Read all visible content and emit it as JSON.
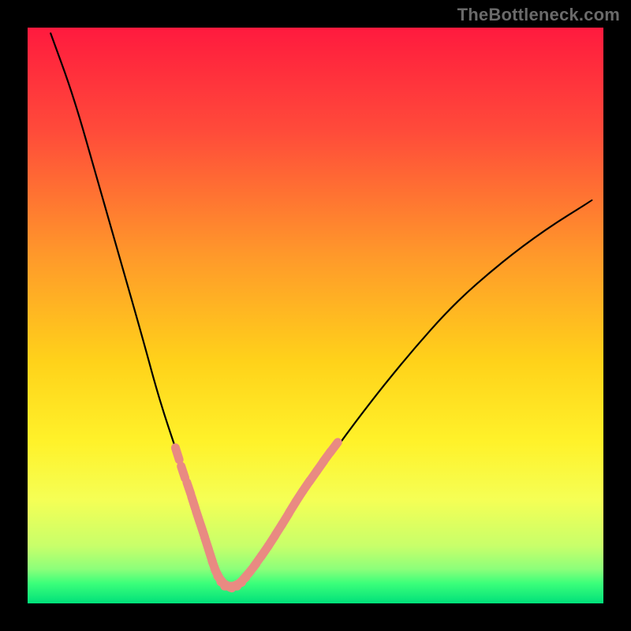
{
  "attribution": "TheBottleneck.com",
  "chart_data": {
    "type": "line",
    "title": "",
    "xlabel": "",
    "ylabel": "",
    "xlim": [
      0,
      100
    ],
    "ylim": [
      0,
      100
    ],
    "note": "V-shaped bottleneck curve over a red→yellow→green vertical gradient. Axes are unlabeled; x/y are normalized 0–100. Small salmon dash markers cluster near the valley on both arms.",
    "gradient_stops": [
      {
        "offset": 0.0,
        "color": "#ff1a3e"
      },
      {
        "offset": 0.18,
        "color": "#ff4b3a"
      },
      {
        "offset": 0.4,
        "color": "#ff9a2a"
      },
      {
        "offset": 0.58,
        "color": "#ffd21a"
      },
      {
        "offset": 0.72,
        "color": "#fff22a"
      },
      {
        "offset": 0.82,
        "color": "#f5ff55"
      },
      {
        "offset": 0.9,
        "color": "#c8ff6a"
      },
      {
        "offset": 0.94,
        "color": "#8dff7a"
      },
      {
        "offset": 0.965,
        "color": "#3cff7a"
      },
      {
        "offset": 1.0,
        "color": "#00e07a"
      }
    ],
    "series": [
      {
        "name": "bottleneck-curve",
        "x": [
          4,
          8,
          12,
          16,
          20,
          23,
          26,
          28,
          30,
          31.5,
          33,
          34.5,
          36,
          38,
          40,
          44,
          50,
          58,
          66,
          74,
          82,
          90,
          98
        ],
        "y": [
          99,
          88,
          74,
          60,
          46,
          35,
          26,
          20,
          14,
          9,
          5,
          3,
          3,
          4.5,
          7,
          13,
          22,
          33,
          43,
          52,
          59,
          65,
          70
        ]
      }
    ],
    "markers": {
      "name": "valley-dashes",
      "points": [
        {
          "x": 26.0,
          "y": 26.0
        },
        {
          "x": 27.0,
          "y": 22.8
        },
        {
          "x": 28.0,
          "y": 20.0
        },
        {
          "x": 28.8,
          "y": 17.5
        },
        {
          "x": 29.6,
          "y": 15.0
        },
        {
          "x": 30.4,
          "y": 12.6
        },
        {
          "x": 31.1,
          "y": 10.4
        },
        {
          "x": 31.8,
          "y": 8.2
        },
        {
          "x": 32.4,
          "y": 6.4
        },
        {
          "x": 33.0,
          "y": 5.0
        },
        {
          "x": 33.7,
          "y": 3.9
        },
        {
          "x": 34.5,
          "y": 3.2
        },
        {
          "x": 35.3,
          "y": 3.0
        },
        {
          "x": 36.2,
          "y": 3.2
        },
        {
          "x": 37.1,
          "y": 3.8
        },
        {
          "x": 38.0,
          "y": 4.8
        },
        {
          "x": 39.0,
          "y": 6.0
        },
        {
          "x": 40.0,
          "y": 7.4
        },
        {
          "x": 41.2,
          "y": 9.1
        },
        {
          "x": 42.4,
          "y": 10.9
        },
        {
          "x": 43.6,
          "y": 12.8
        },
        {
          "x": 44.8,
          "y": 14.7
        },
        {
          "x": 46.0,
          "y": 16.7
        },
        {
          "x": 47.2,
          "y": 18.6
        },
        {
          "x": 48.4,
          "y": 20.4
        },
        {
          "x": 49.6,
          "y": 22.1
        },
        {
          "x": 50.8,
          "y": 23.8
        },
        {
          "x": 52.0,
          "y": 25.5
        },
        {
          "x": 53.2,
          "y": 27.1
        }
      ]
    }
  }
}
